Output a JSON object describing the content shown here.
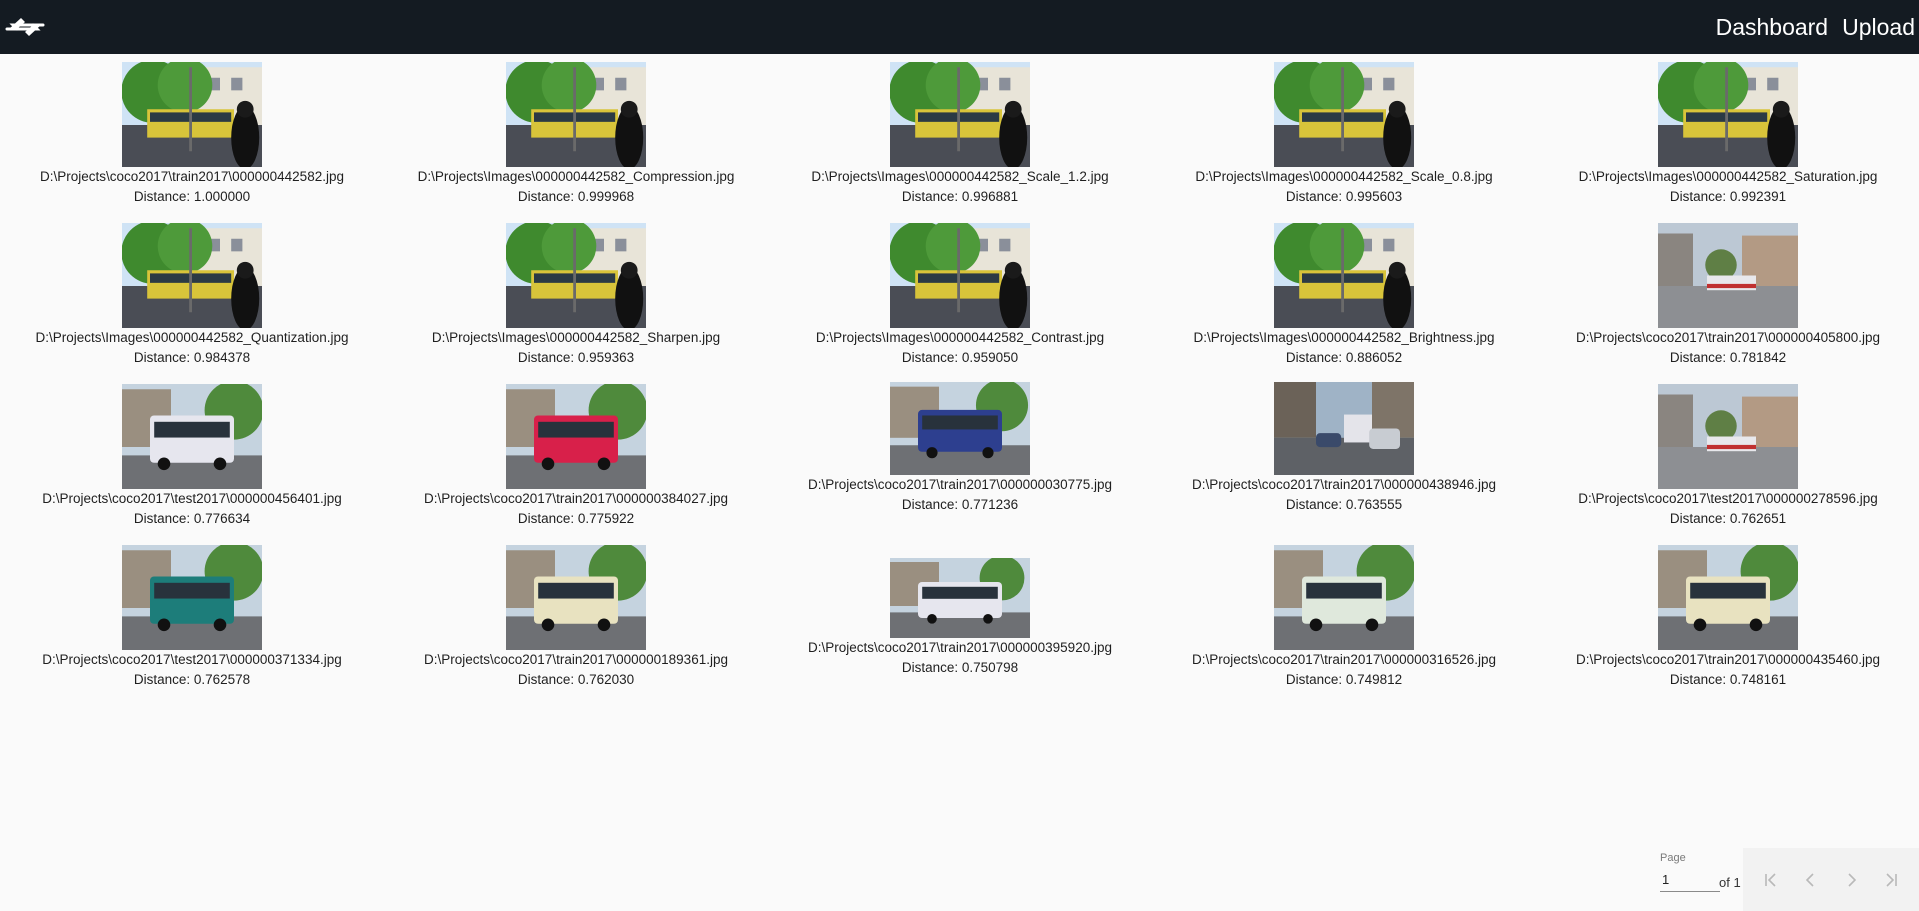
{
  "header": {
    "nav": [
      "Dashboard",
      "Upload"
    ]
  },
  "results": [
    {
      "path": "D:\\Projects\\coco2017\\train2017\\000000442582.jpg",
      "distance": "Distance: 1.000000",
      "scene": "street"
    },
    {
      "path": "D:\\Projects\\Images\\000000442582_Compression.jpg",
      "distance": "Distance: 0.999968",
      "scene": "street"
    },
    {
      "path": "D:\\Projects\\Images\\000000442582_Scale_1.2.jpg",
      "distance": "Distance: 0.996881",
      "scene": "street"
    },
    {
      "path": "D:\\Projects\\Images\\000000442582_Scale_0.8.jpg",
      "distance": "Distance: 0.995603",
      "scene": "street"
    },
    {
      "path": "D:\\Projects\\Images\\000000442582_Saturation.jpg",
      "distance": "Distance: 0.992391",
      "scene": "street"
    },
    {
      "path": "D:\\Projects\\Images\\000000442582_Quantization.jpg",
      "distance": "Distance: 0.984378",
      "scene": "street"
    },
    {
      "path": "D:\\Projects\\Images\\000000442582_Sharpen.jpg",
      "distance": "Distance: 0.959363",
      "scene": "street"
    },
    {
      "path": "D:\\Projects\\Images\\000000442582_Contrast.jpg",
      "distance": "Distance: 0.959050",
      "scene": "street"
    },
    {
      "path": "D:\\Projects\\Images\\000000442582_Brightness.jpg",
      "distance": "Distance: 0.886052",
      "scene": "street"
    },
    {
      "path": "D:\\Projects\\coco2017\\train2017\\000000405800.jpg",
      "distance": "Distance: 0.781842",
      "scene": "road"
    },
    {
      "path": "D:\\Projects\\coco2017\\test2017\\000000456401.jpg",
      "distance": "Distance: 0.776634",
      "scene": "bus-white"
    },
    {
      "path": "D:\\Projects\\coco2017\\train2017\\000000384027.jpg",
      "distance": "Distance: 0.775922",
      "scene": "bus-red"
    },
    {
      "path": "D:\\Projects\\coco2017\\train2017\\000000030775.jpg",
      "distance": "Distance: 0.771236",
      "scene": "bus-blue"
    },
    {
      "path": "D:\\Projects\\coco2017\\train2017\\000000438946.jpg",
      "distance": "Distance: 0.763555",
      "scene": "traffic"
    },
    {
      "path": "D:\\Projects\\coco2017\\test2017\\000000278596.jpg",
      "distance": "Distance: 0.762651",
      "scene": "road"
    },
    {
      "path": "D:\\Projects\\coco2017\\test2017\\000000371334.jpg",
      "distance": "Distance: 0.762578",
      "scene": "bus-teal"
    },
    {
      "path": "D:\\Projects\\coco2017\\train2017\\000000189361.jpg",
      "distance": "Distance: 0.762030",
      "scene": "bus-cream"
    },
    {
      "path": "D:\\Projects\\coco2017\\train2017\\000000395920.jpg",
      "distance": "Distance: 0.750798",
      "scene": "bus-white"
    },
    {
      "path": "D:\\Projects\\coco2017\\train2017\\000000316526.jpg",
      "distance": "Distance: 0.749812",
      "scene": "bus-front"
    },
    {
      "path": "D:\\Projects\\coco2017\\train2017\\000000435460.jpg",
      "distance": "Distance: 0.748161",
      "scene": "bus-cream"
    }
  ],
  "pagination": {
    "label": "Page",
    "current": "1",
    "of_text": "of 1"
  },
  "colors": {
    "topbar": "#141b22",
    "background": "#fafafa",
    "text": "#1f1f1f"
  }
}
